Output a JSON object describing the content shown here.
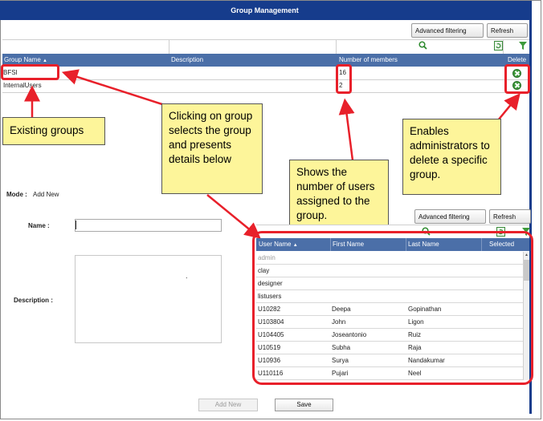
{
  "title": "Group Management",
  "top_toolbar": {
    "advanced_filtering": "Advanced filtering",
    "refresh": "Refresh"
  },
  "groups_table": {
    "columns": [
      "Group Name",
      "Description",
      "Number of members",
      "Delete"
    ],
    "rows": [
      {
        "name": "BFSI",
        "description": "",
        "members": "16"
      },
      {
        "name": "InternalUsers",
        "description": "",
        "members": "2"
      }
    ]
  },
  "callouts": {
    "existing_groups": "Existing groups",
    "clicking": "Clicking on group selects the group and presents details below",
    "shows": "Shows the number of users assigned to the group.",
    "enables": "Enables administrators to delete a specific group."
  },
  "form": {
    "mode_label": "Mode :",
    "mode_value": "Add New",
    "name_label": "Name :",
    "name_value": "",
    "description_label": "Description :",
    "description_value": "."
  },
  "users_toolbar": {
    "advanced_filtering": "Advanced filtering",
    "refresh": "Refresh"
  },
  "users_table": {
    "columns": [
      "User Name",
      "First Name",
      "Last Name",
      "Selected"
    ],
    "rows": [
      {
        "user": "admin",
        "first": "",
        "last": ""
      },
      {
        "user": "clay",
        "first": "",
        "last": ""
      },
      {
        "user": "designer",
        "first": "",
        "last": ""
      },
      {
        "user": "listusers",
        "first": "",
        "last": ""
      },
      {
        "user": "U10282",
        "first": "Deepa",
        "last": "Gopinathan"
      },
      {
        "user": "U103804",
        "first": "John",
        "last": "Ligon"
      },
      {
        "user": "U104405",
        "first": "Joseantonio",
        "last": "Ruiz"
      },
      {
        "user": "U10519",
        "first": "Subha",
        "last": "Raja"
      },
      {
        "user": "U10936",
        "first": "Surya",
        "last": "Nandakumar"
      },
      {
        "user": "U110116",
        "first": "Pujari",
        "last": "Neel"
      }
    ]
  },
  "footer": {
    "add_new": "Add New",
    "save": "Save"
  },
  "colors": {
    "title_bar": "#163c8c",
    "header": "#4b6fa8",
    "callout": "#fdf59a",
    "highlight": "#e8202a",
    "delete_icon": "#3d9a3a"
  }
}
